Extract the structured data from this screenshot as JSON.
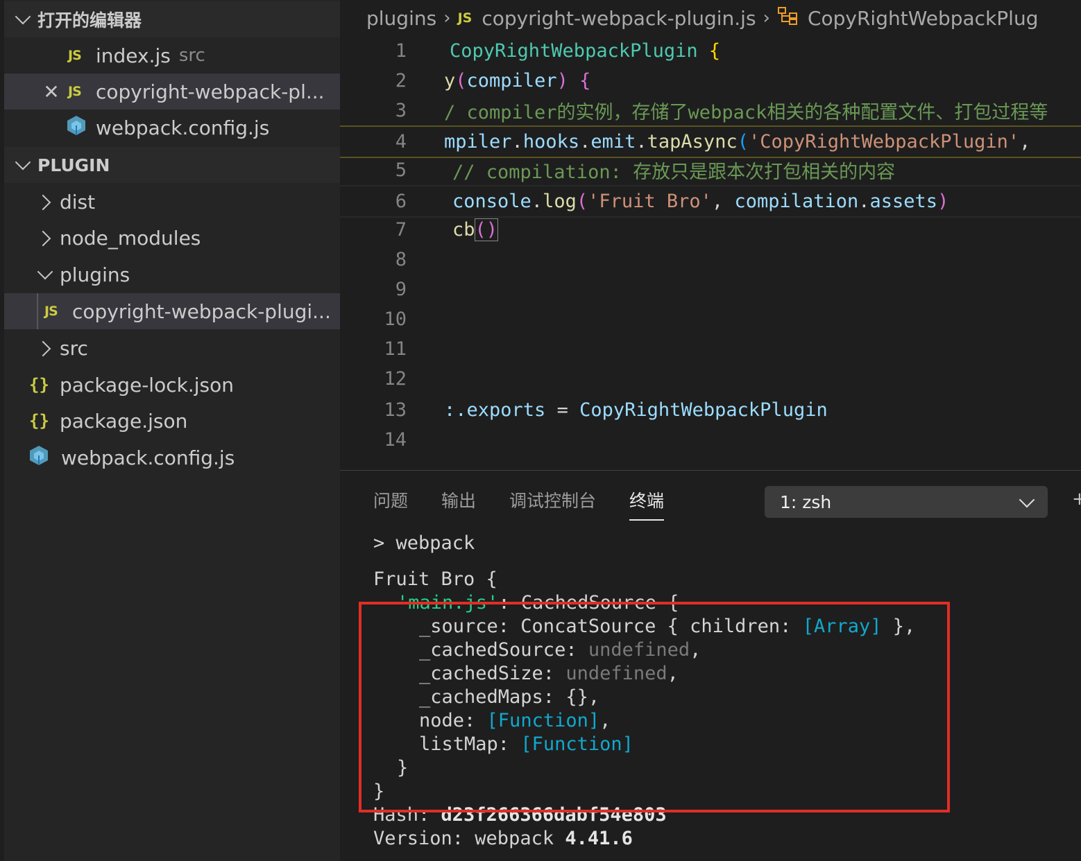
{
  "sidebar": {
    "open_editors_title": "打开的编辑器",
    "open_editors": [
      {
        "name": "index.js",
        "hint": "src",
        "icon": "js-icon"
      },
      {
        "name": "copyright-webpack-pl...",
        "icon": "js-icon"
      },
      {
        "name": "webpack.config.js",
        "icon": "webpack-cube-icon"
      }
    ],
    "project_title": "PLUGIN",
    "tree": [
      {
        "name": "dist",
        "type": "folder"
      },
      {
        "name": "node_modules",
        "type": "folder"
      },
      {
        "name": "plugins",
        "type": "folder-open"
      },
      {
        "name": "copyright-webpack-plugi...",
        "type": "js-file"
      },
      {
        "name": "src",
        "type": "folder"
      },
      {
        "name": "package-lock.json",
        "type": "json-file"
      },
      {
        "name": "package.json",
        "type": "json-file"
      },
      {
        "name": "webpack.config.js",
        "type": "webpack-file"
      }
    ]
  },
  "breadcrumb": {
    "folder": "plugins",
    "file": "copyright-webpack-plugin.js",
    "symbol": "CopyRightWebpackPlug"
  },
  "editor": {
    "line_numbers": [
      "1",
      "2",
      "3",
      "4",
      "5",
      "6",
      "7",
      "8",
      "9",
      "10",
      "11",
      "12",
      "13",
      "14"
    ],
    "l1": {
      "cls": "CopyRightWebpackPlugin",
      "brace": "{"
    },
    "l2": {
      "fn": "y",
      "p1": "(",
      "param": "compiler",
      "p2": ")",
      "brace": "{"
    },
    "l3": {
      "comment": "/ compiler的实例，存储了webpack相关的各种配置文件、打包过程等"
    },
    "l4": {
      "a": "mpiler",
      "d1": ".",
      "b": "hooks",
      "d2": ".",
      "c": "emit",
      "d3": ".",
      "fn": "tapAsync",
      "p": "(",
      "str": "'CopyRightWebpackPlugin'",
      "comma": ","
    },
    "l5": {
      "comment": "// compilation: 存放只是跟本次打包相关的内容"
    },
    "l6": {
      "obj": "console",
      "d1": ".",
      "fn": "log",
      "p1": "(",
      "str": "'Fruit Bro'",
      "comma": ", ",
      "a": "compilation",
      "d2": ".",
      "b": "assets",
      "p2": ")"
    },
    "l7": {
      "fn": "cb",
      "p": "()"
    },
    "l13": {
      "a": ":",
      "b": ".exports",
      "eq": " = ",
      "cls": "CopyRightWebpackPlugin"
    }
  },
  "panel": {
    "tabs": [
      "问题",
      "输出",
      "调试控制台",
      "终端"
    ],
    "active_tab": "终端",
    "terminal_select": "1: zsh",
    "plus": "+"
  },
  "terminal": {
    "cmd": "> webpack",
    "t1": "Fruit Bro {",
    "t2_key": "'main.js'",
    "t2_rest": ": CachedSource {",
    "t3_key": "_source: ConcatSource { children: ",
    "t3_arr": "[Array]",
    "t3_end": " },",
    "t4_key": "_cachedSource: ",
    "t4_val": "undefined",
    "t4_end": ",",
    "t5_key": "_cachedSize: ",
    "t5_val": "undefined",
    "t5_end": ",",
    "t6": "_cachedMaps: {},",
    "t7_key": "node: ",
    "t7_val": "[Function]",
    "t7_end": ",",
    "t8_key": "listMap: ",
    "t8_val": "[Function]",
    "t9": "}",
    "t10": "}",
    "hash_label": "Hash: ",
    "hash_val": "d23f266366dabf54e803",
    "ver_label": "Version: webpack ",
    "ver_val": "4.41.6"
  },
  "colors": {
    "highlight_box": "#e22d26",
    "js_icon": "#cbcb41",
    "webpack_icon": "#519aba"
  }
}
